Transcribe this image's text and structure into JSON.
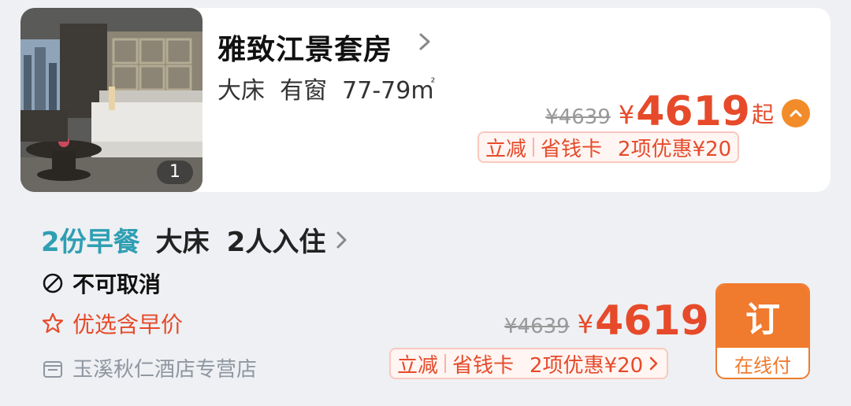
{
  "room": {
    "name": "雅致江景套房",
    "bed": "大床",
    "window": "有窗",
    "area": "77-79m",
    "area_unit_sup": "²",
    "photo_count": "1",
    "original_price": "¥4639",
    "currency": "¥",
    "price": "4619",
    "price_suffix": "起",
    "promo": {
      "tag1": "立减",
      "tag2": "省钱卡",
      "discount": "2项优惠¥20"
    }
  },
  "rate": {
    "meal": "2份早餐",
    "bed": "大床",
    "occupancy": "2人入住",
    "cancel_policy": "不可取消",
    "package": "优选含早价",
    "shop": "玉溪秋仁酒店专营店",
    "original_price": "¥4639",
    "currency": "¥",
    "price": "4619",
    "promo": {
      "tag1": "立减",
      "tag2": "省钱卡",
      "discount": "2项优惠¥20"
    },
    "book_label": "订",
    "book_sub": "在线付"
  },
  "colors": {
    "accent": "#e64a2a",
    "orange": "#f07a2e",
    "teal": "#2f9fb3",
    "background": "#eef0f3"
  },
  "icons": [
    "chevron-right-icon",
    "chevron-up-icon",
    "no-cancel-icon",
    "star-icon",
    "shop-icon"
  ]
}
